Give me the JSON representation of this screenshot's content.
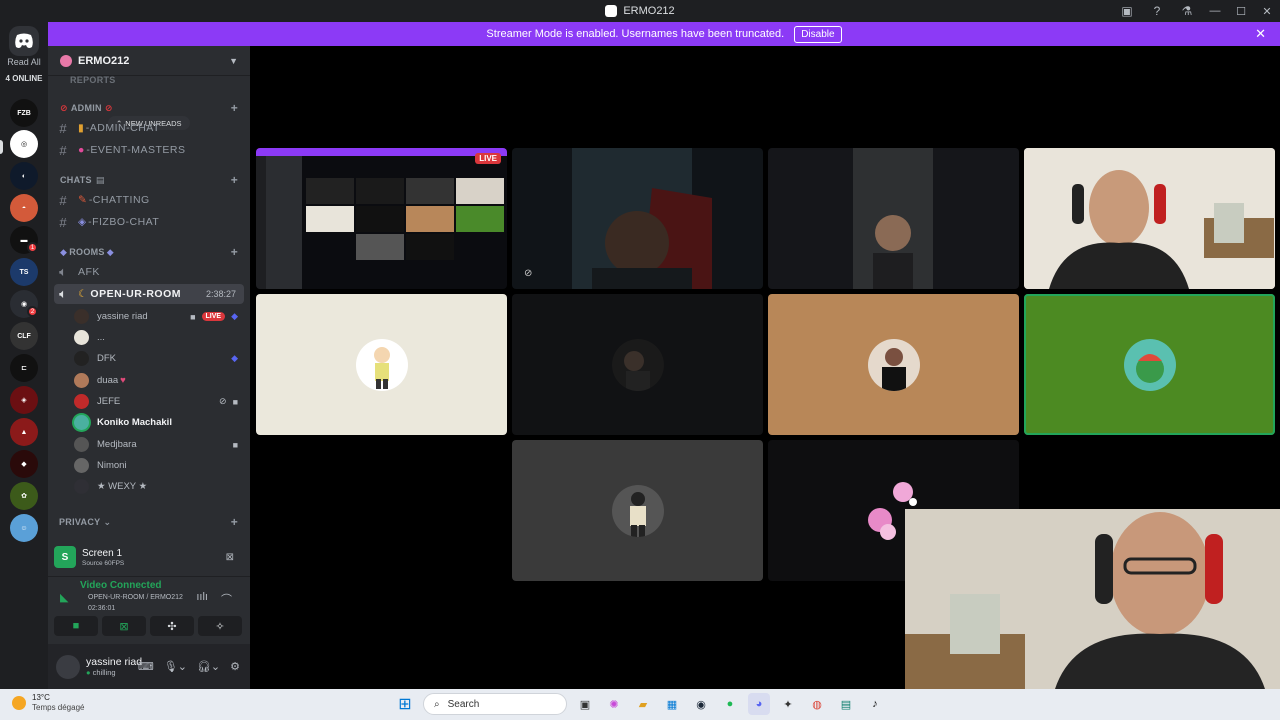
{
  "window": {
    "title": "ERMO212"
  },
  "rail": {
    "read_all": "Read All",
    "online": "4 ONLINE",
    "badges": [
      "1",
      "2"
    ]
  },
  "banner": {
    "text": "Streamer Mode is enabled. Usernames have been truncated.",
    "disable_label": "Disable"
  },
  "guild": {
    "name": "ERMO212"
  },
  "channels": {
    "new_unreads": "NEW UNREADS",
    "rows": [
      {
        "kind": "partial",
        "label": "REPORTS"
      },
      {
        "kind": "category",
        "label": "ADMIN"
      },
      {
        "kind": "text",
        "label": "-ADMIN-CHAT"
      },
      {
        "kind": "text",
        "label": "-EVENT-MASTERS"
      },
      {
        "kind": "category",
        "label": "CHATS"
      },
      {
        "kind": "text",
        "label": "-CHATTING"
      },
      {
        "kind": "text",
        "label": "-FIZBO-CHAT"
      },
      {
        "kind": "category",
        "label": "ROOMS"
      },
      {
        "kind": "voice",
        "label": "AFK"
      },
      {
        "kind": "voice",
        "label": "OPEN-UR-ROOM",
        "timer": "2:38:27"
      }
    ],
    "voice_users": [
      {
        "name": "yassine riad",
        "live": "LIVE"
      },
      {
        "name": "..."
      },
      {
        "name": "DFK"
      },
      {
        "name": "duaa"
      },
      {
        "name": "JEFE"
      },
      {
        "name": "Koniko Machakil"
      },
      {
        "name": "Medjbara"
      },
      {
        "name": "Nimoni"
      },
      {
        "name": "★ WEXY ★"
      }
    ],
    "privacy_category": "PRIVACY"
  },
  "share": {
    "title": "Screen 1",
    "subtitle": "Source 60FPS"
  },
  "voice_connection": {
    "status": "Video Connected",
    "channel": "OPEN-UR-ROOM / ERMO212",
    "time": "02:36:01"
  },
  "user_panel": {
    "name": "yassine riad",
    "status": "chilling"
  },
  "video_grid": {
    "live_tag": "LIVE"
  },
  "taskbar": {
    "temp": "13°C",
    "weather": "Temps dégagé",
    "search_label": "Search"
  }
}
